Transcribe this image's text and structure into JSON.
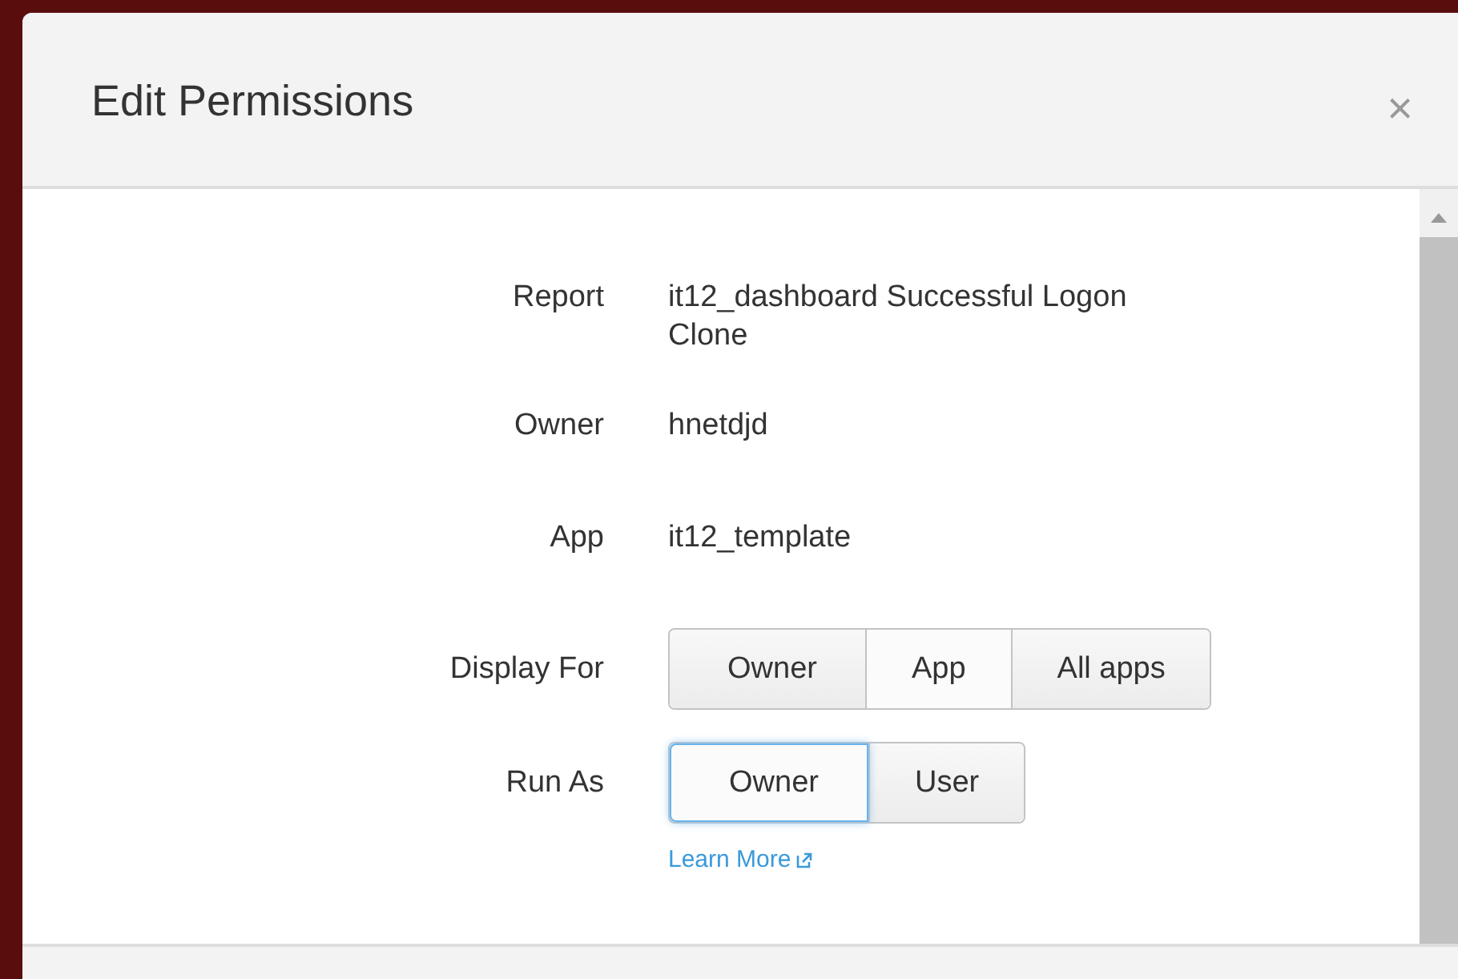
{
  "dialog": {
    "title": "Edit Permissions",
    "close": "×"
  },
  "fields": [
    {
      "kind": "text",
      "label": "Report",
      "value": "it12_dashboard Successful Logon Clone"
    },
    {
      "kind": "text",
      "label": "Owner",
      "value": "hnetdjd"
    },
    {
      "kind": "text",
      "label": "App",
      "value": "it12_template"
    },
    {
      "kind": "segmented",
      "label": "Display For",
      "options": [
        {
          "label": "Owner",
          "selected": false
        },
        {
          "label": "App",
          "selected": true
        },
        {
          "label": "All apps",
          "selected": false
        }
      ]
    },
    {
      "kind": "segmented",
      "label": "Run As",
      "options": [
        {
          "label": "Owner",
          "selected": true
        },
        {
          "label": "User",
          "selected": false
        }
      ],
      "link": "Learn More"
    }
  ]
}
